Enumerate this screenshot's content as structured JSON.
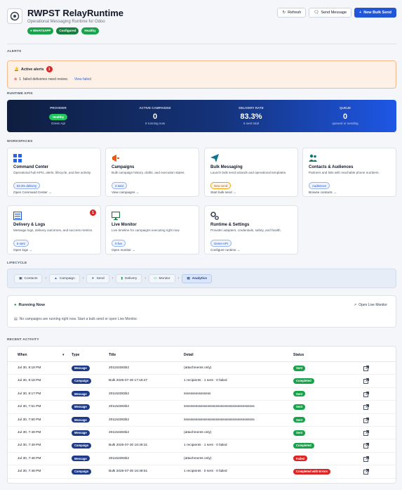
{
  "header": {
    "title": "RWPST RelayRuntime",
    "subtitle": "Operational Messaging Runtime for Odoo",
    "chips": [
      "WHATSAPP",
      "Configured",
      "Healthy"
    ],
    "buttons": {
      "refresh": "Refresh",
      "send_message": "Send Message",
      "new_bulk": "New Bulk Send"
    }
  },
  "alerts": {
    "section_label": "ALERTS",
    "title": "Active alerts",
    "count": "1",
    "row_count": "1",
    "row_text": "failed deliveries need review.",
    "row_link": "View failed"
  },
  "kpis": {
    "section_label": "RUNTIME KPIS",
    "items": [
      {
        "label": "PROVIDER",
        "value": "Healthy",
        "sub": "Green Api"
      },
      {
        "label": "ACTIVE CAMPAIGNS",
        "value": "0",
        "sub": "0 running now"
      },
      {
        "label": "DELIVERY RATE",
        "value": "83.3%",
        "sub": "5 sent total"
      },
      {
        "label": "QUEUE",
        "value": "0",
        "sub": "queued or sending"
      }
    ]
  },
  "workspaces": {
    "section_label": "WORKSPACES",
    "cards": [
      {
        "title": "Command Center",
        "desc": "Operational hub KPIs, alerts, lifecycle, and live activity.",
        "tag": "83.3% delivery",
        "foot": "Open Command Center",
        "icon": "grid-icon"
      },
      {
        "title": "Campaigns",
        "desc": "Bulk campaign history, drafts, and execution states.",
        "tag": "3 total",
        "foot": "View campaigns",
        "icon": "megaphone-icon"
      },
      {
        "title": "Bulk Messaging",
        "desc": "Launch bulk send wizards and operational templates.",
        "tag": "New send",
        "foot": "Start bulk send",
        "icon": "paper-plane-icon"
      },
      {
        "title": "Contacts & Audiences",
        "desc": "Partners and lists with reachable phone numbers.",
        "tag": "Audiences",
        "foot": "Browse contacts",
        "icon": "users-icon"
      },
      {
        "title": "Delivery & Logs",
        "desc": "Message logs, delivery outcomes, and success metrics.",
        "tag": "5 sent",
        "foot": "Open logs",
        "icon": "list-icon",
        "badge": "1"
      },
      {
        "title": "Live Monitor",
        "desc": "Live timeline for campaigns executing right now.",
        "tag": "0 live",
        "foot": "Open monitor",
        "icon": "monitor-icon"
      },
      {
        "title": "Runtime & Settings",
        "desc": "Provider adapters, credentials, safety, and health.",
        "tag": "Green API",
        "foot": "Configure runtime",
        "icon": "gears-icon"
      }
    ]
  },
  "lifecycle": {
    "section_label": "LIFECYCLE",
    "steps": [
      "Contacts",
      "Campaign",
      "Send",
      "Delivery",
      "Monitor",
      "Analytics"
    ]
  },
  "running": {
    "title": "Running Now",
    "link": "Open Live Monitor",
    "message": "No campaigns are running right now. Start a bulk send or open Live Monitor."
  },
  "activity": {
    "section_label": "RECENT ACTIVITY",
    "headers": {
      "when": "When",
      "type": "Type",
      "title": "Title",
      "detail": "Detail",
      "status": "Status"
    },
    "rows": [
      {
        "when": "Jul 30, 8:18 PM",
        "type": "Message",
        "title": "201153383b2",
        "detail": "(attachments only)",
        "status": "Sent",
        "st": "sent"
      },
      {
        "when": "Jul 30, 8:18 PM",
        "type": "Campaign",
        "title": "Bulk 2026-07-30 17:18:47",
        "detail": "1 recipients · 1 sent · 0 failed",
        "status": "Completed",
        "st": "completed"
      },
      {
        "when": "Jul 30, 8:17 PM",
        "type": "Message",
        "title": "201153383b2",
        "detail": "ssssssssssssssss",
        "status": "Sent",
        "st": "sent"
      },
      {
        "when": "Jul 30, 7:51 PM",
        "type": "Message",
        "title": "201153383b2",
        "detail": "ssssssssssssssssssssssssssssssssssssssssss",
        "status": "Sent",
        "st": "sent"
      },
      {
        "when": "Jul 30, 7:50 PM",
        "type": "Message",
        "title": "201153383b2",
        "detail": "ssssssssssssssssssssssssssssssssssssssssss",
        "status": "Sent",
        "st": "sent"
      },
      {
        "when": "Jul 30, 7:49 PM",
        "type": "Message",
        "title": "201153383b2",
        "detail": "(attachments only)",
        "status": "Sent",
        "st": "sent"
      },
      {
        "when": "Jul 30, 7:49 PM",
        "type": "Campaign",
        "title": "Bulk 2026-07-30 16:49:31",
        "detail": "1 recipients · 1 sent · 0 failed",
        "status": "Completed",
        "st": "completed"
      },
      {
        "when": "Jul 30, 7:48 PM",
        "type": "Message",
        "title": "201153383b2",
        "detail": "(attachments only)",
        "status": "Failed",
        "st": "failed"
      },
      {
        "when": "Jul 30, 7:48 PM",
        "type": "Campaign",
        "title": "Bulk 2026-07-30 16:48:51",
        "detail": "1 recipients · 0 sent · 0 failed",
        "status": "Completed with Errors",
        "st": "errors"
      }
    ]
  }
}
